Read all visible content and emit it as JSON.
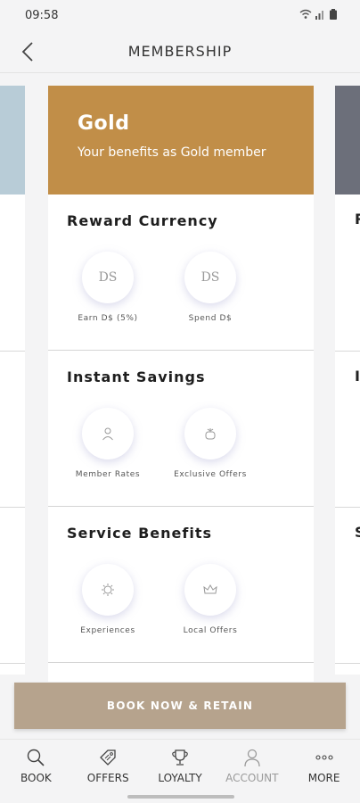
{
  "status": {
    "time": "09:58"
  },
  "header": {
    "title": "MEMBERSHIP"
  },
  "side_cards": {
    "right_letters": [
      "R",
      "I",
      "S"
    ]
  },
  "tier": {
    "name": "Gold",
    "subtitle": "Your benefits as Gold member",
    "color": "#c18e48"
  },
  "sections": [
    {
      "title": "Reward Currency",
      "benefits": [
        {
          "icon": "ds-icon",
          "icon_text": "DS",
          "label": "Earn D$ (5%)"
        },
        {
          "icon": "ds-icon",
          "icon_text": "DS",
          "label": "Spend D$"
        }
      ]
    },
    {
      "title": "Instant Savings",
      "benefits": [
        {
          "icon": "member-icon",
          "label": "Member Rates"
        },
        {
          "icon": "gift-icon",
          "label": "Exclusive Offers"
        }
      ]
    },
    {
      "title": "Service Benefits",
      "benefits": [
        {
          "icon": "sparkle-icon",
          "label": "Experiences"
        },
        {
          "icon": "crown-icon",
          "label": "Local Offers"
        }
      ]
    }
  ],
  "cta": {
    "label": "BOOK NOW & RETAIN",
    "color": "#b6a38d"
  },
  "nav": [
    {
      "label": "BOOK",
      "icon": "search-icon"
    },
    {
      "label": "OFFERS",
      "icon": "tag-icon"
    },
    {
      "label": "LOYALTY",
      "icon": "trophy-icon"
    },
    {
      "label": "ACCOUNT",
      "icon": "user-icon"
    },
    {
      "label": "MORE",
      "icon": "more-icon"
    }
  ]
}
